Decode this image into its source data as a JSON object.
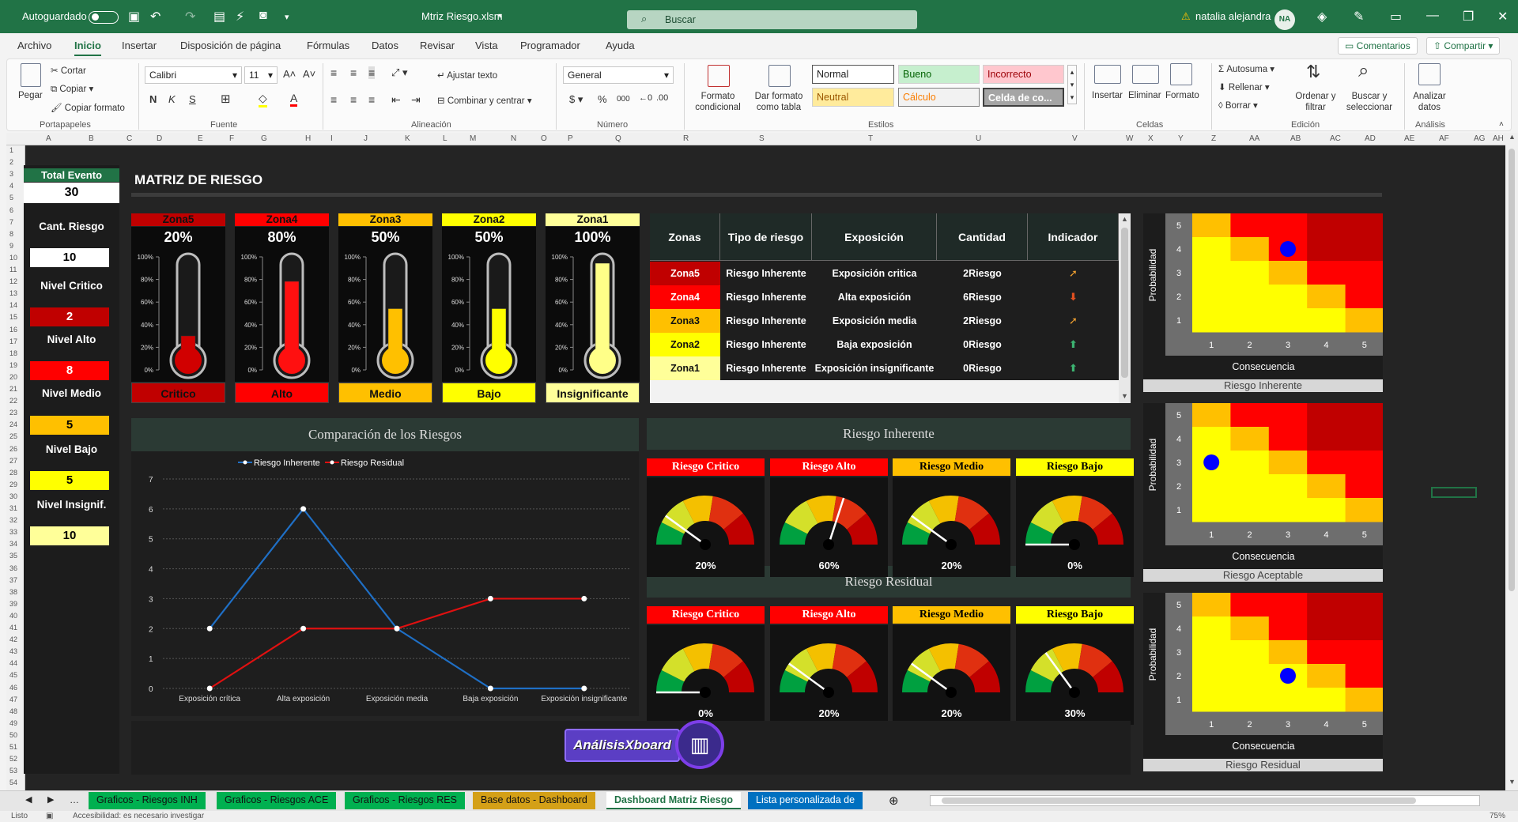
{
  "window": {
    "autosave_label": "Autoguardado",
    "file_name": "Mtriz Riesgo.xlsm",
    "search_placeholder": "Buscar",
    "user_name": "natalia alejandra",
    "user_initials": "NA"
  },
  "menu": [
    "Archivo",
    "Inicio",
    "Insertar",
    "Disposición de página",
    "Fórmulas",
    "Datos",
    "Revisar",
    "Vista",
    "Programador",
    "Ayuda"
  ],
  "menu_right": {
    "comments": "Comentarios",
    "share": "Compartir"
  },
  "ribbon": {
    "clipboard": {
      "paste": "Pegar",
      "cut": "Cortar",
      "copy": "Copiar",
      "format_painter": "Copiar formato",
      "group": "Portapapeles"
    },
    "font": {
      "name": "Calibri",
      "size": "11",
      "group": "Fuente"
    },
    "alignment": {
      "wrap": "Ajustar texto",
      "merge": "Combinar y centrar",
      "group": "Alineación"
    },
    "number": {
      "format": "General",
      "group": "Número"
    },
    "styles": {
      "conditional": "Formato condicional",
      "table": "Dar formato como tabla",
      "normal": "Normal",
      "good": "Bueno",
      "bad": "Incorrecto",
      "neutral": "Neutral",
      "calc": "Cálculo",
      "check": "Celda de co...",
      "group": "Estilos"
    },
    "cells": {
      "insert": "Insertar",
      "delete": "Eliminar",
      "format": "Formato",
      "group": "Celdas"
    },
    "editing": {
      "autosum": "Autosuma",
      "fill": "Rellenar",
      "clear": "Borrar",
      "sort": "Ordenar y filtrar",
      "find": "Buscar y seleccionar",
      "group": "Edición"
    },
    "analysis": {
      "analyze": "Analizar datos",
      "group": "Análisis"
    }
  },
  "columns": [
    "A",
    "B",
    "C",
    "D",
    "E",
    "F",
    "G",
    "H",
    "I",
    "J",
    "K",
    "L",
    "M",
    "N",
    "O",
    "P",
    "Q",
    "R",
    "S",
    "T",
    "U",
    "V",
    "W",
    "X",
    "Y",
    "Z",
    "AA",
    "AB",
    "AC",
    "AD",
    "AE",
    "AF",
    "AG",
    "AH"
  ],
  "dashboard": {
    "title": "MATRIZ DE RIESGO",
    "total_event_label": "Total Evento",
    "total_event_value": "30",
    "kpis": [
      {
        "label": "Cant. Riesgo",
        "value": "10",
        "bg": "#ffffff",
        "fg": "#000000"
      },
      {
        "label": "Nivel Critico",
        "value": "2",
        "bg": "#c00000",
        "fg": "#ffffff"
      },
      {
        "label": "Nivel Alto",
        "value": "8",
        "bg": "#ff0000",
        "fg": "#ffffff"
      },
      {
        "label": "Nivel Medio",
        "value": "5",
        "bg": "#ffc000",
        "fg": "#000000"
      },
      {
        "label": "Nivel Bajo",
        "value": "5",
        "bg": "#ffff00",
        "fg": "#000000"
      },
      {
        "label": "Nivel Insignif.",
        "value": "10",
        "bg": "#ffff99",
        "fg": "#000000"
      }
    ],
    "zones": [
      {
        "zone": "Zona5",
        "pct": "20%",
        "level": 0.2,
        "label": "Critico",
        "color": "#c00000",
        "fill": "#d10000"
      },
      {
        "zone": "Zona4",
        "pct": "80%",
        "level": 0.8,
        "label": "Alto",
        "color": "#ff0000",
        "fill": "#ff1010"
      },
      {
        "zone": "Zona3",
        "pct": "50%",
        "level": 0.5,
        "label": "Medio",
        "color": "#ffc000",
        "fill": "#ffc000"
      },
      {
        "zone": "Zona2",
        "pct": "50%",
        "level": 0.5,
        "label": "Bajo",
        "color": "#ffff00",
        "fill": "#ffff00"
      },
      {
        "zone": "Zona1",
        "pct": "100%",
        "level": 1.0,
        "label": "Insignificante",
        "color": "#ffff99",
        "fill": "#ffff88"
      }
    ],
    "thermo_ticks": [
      "100%",
      "80%",
      "60%",
      "40%",
      "20%",
      "0%"
    ],
    "table": {
      "headers": [
        "Zonas",
        "Tipo de riesgo",
        "Exposición",
        "Cantidad",
        "Indicador"
      ],
      "rows": [
        {
          "zone": "Zona5",
          "type": "Riesgo Inherente",
          "exposure": "Exposición critica",
          "qty": "2Riesgo",
          "indicator": "arrow-up-right-icon",
          "ind_color": "#f0a030",
          "glyph": "➚"
        },
        {
          "zone": "Zona4",
          "type": "Riesgo Inherente",
          "exposure": "Alta exposición",
          "qty": "6Riesgo",
          "indicator": "arrow-down-icon",
          "ind_color": "#e05020",
          "glyph": "⬇"
        },
        {
          "zone": "Zona3",
          "type": "Riesgo Inherente",
          "exposure": "Exposición media",
          "qty": "2Riesgo",
          "indicator": "arrow-up-right-icon",
          "ind_color": "#f0a030",
          "glyph": "➚"
        },
        {
          "zone": "Zona2",
          "type": "Riesgo Inherente",
          "exposure": "Baja exposición",
          "qty": "0Riesgo",
          "indicator": "arrow-up-icon",
          "ind_color": "#3cb371",
          "glyph": "⬆"
        },
        {
          "zone": "Zona1",
          "type": "Riesgo Inherente",
          "exposure": "Exposición insignificante",
          "qty": "0Riesgo",
          "indicator": "arrow-up-icon",
          "ind_color": "#3cb371",
          "glyph": "⬆"
        }
      ]
    },
    "gauge_titles": {
      "inherent": "Riesgo Inherente",
      "residual": "Riesgo Residual"
    },
    "gauges_inherent": [
      {
        "title": "Riesgo Critico",
        "value": "20%",
        "frac": 0.2,
        "bg": "#ff0000",
        "fg": "#ffffff"
      },
      {
        "title": "Riesgo Alto",
        "value": "60%",
        "frac": 0.6,
        "bg": "#ff0000",
        "fg": "#ffffff"
      },
      {
        "title": "Riesgo Medio",
        "value": "20%",
        "frac": 0.2,
        "bg": "#ffc000",
        "fg": "#000000"
      },
      {
        "title": "Riesgo Bajo",
        "value": "0%",
        "frac": 0.0,
        "bg": "#ffff00",
        "fg": "#000000"
      }
    ],
    "gauges_residual": [
      {
        "title": "Riesgo Critico",
        "value": "0%",
        "frac": 0.0,
        "bg": "#ff0000",
        "fg": "#ffffff"
      },
      {
        "title": "Riesgo Alto",
        "value": "20%",
        "frac": 0.2,
        "bg": "#ff0000",
        "fg": "#ffffff"
      },
      {
        "title": "Riesgo Medio",
        "value": "20%",
        "frac": 0.2,
        "bg": "#ffc000",
        "fg": "#000000"
      },
      {
        "title": "Riesgo Bajo",
        "value": "30%",
        "frac": 0.3,
        "bg": "#ffff00",
        "fg": "#000000"
      }
    ],
    "heatmaps": [
      {
        "footer": "Riesgo Inherente",
        "dot": [
          3,
          4
        ]
      },
      {
        "footer": "Riesgo Aceptable",
        "dot": [
          1,
          3
        ]
      },
      {
        "footer": "Riesgo Residual",
        "dot": [
          3,
          2
        ]
      }
    ],
    "heatmap_axis": {
      "y": "Probabilidad",
      "x": "Consecuencia",
      "ticks": [
        "1",
        "2",
        "3",
        "4",
        "5"
      ]
    },
    "brand": "AnálisisXboard"
  },
  "chart_data": {
    "type": "line",
    "title": "Comparación de los Riesgos",
    "categories": [
      "Exposición crítica",
      "Alta exposición",
      "Exposición media",
      "Baja exposición",
      "Exposición insignificante"
    ],
    "series": [
      {
        "name": "Riesgo Inherente",
        "values": [
          2,
          6,
          2,
          0,
          0
        ],
        "color": "#1f6fc5"
      },
      {
        "name": "Riesgo Residual",
        "values": [
          0,
          2,
          2,
          3,
          3
        ],
        "color": "#e01010"
      }
    ],
    "ylim": [
      0,
      7
    ],
    "yticks": [
      "0",
      "1",
      "2",
      "3",
      "4",
      "5",
      "6",
      "7"
    ],
    "legend": "top",
    "grid": true
  },
  "tabs": [
    {
      "label": "Graficos - Riesgos INH",
      "color": "#00b050"
    },
    {
      "label": "Graficos - Riesgos ACE",
      "color": "#00b050"
    },
    {
      "label": "Graficos - Riesgos RES",
      "color": "#00b050"
    },
    {
      "label": "Base datos - Dashboard",
      "color": "#d4a017"
    },
    {
      "label": "Dashboard Matriz Riesgo",
      "color": "#ffffff"
    },
    {
      "label": "Lista personalizada de",
      "color": "#0070c0"
    }
  ],
  "status": {
    "ready": "Listo",
    "accessibility": "Accesibilidad: es necesario investigar",
    "zoom": "75%"
  }
}
